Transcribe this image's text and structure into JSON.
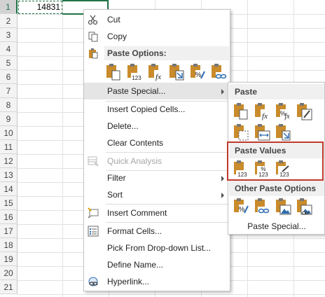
{
  "sheet": {
    "row_numbers": [
      "1",
      "2",
      "3",
      "4",
      "5",
      "6",
      "7",
      "8",
      "9",
      "10",
      "11",
      "12",
      "13",
      "14",
      "15",
      "16",
      "17",
      "18",
      "19",
      "20",
      "21"
    ],
    "cell_a1_value": "14831"
  },
  "context_menu": {
    "cut": "Cut",
    "copy": "Copy",
    "paste_options_header": "Paste Options:",
    "paste_special": "Paste Special...",
    "insert_copied_cells": "Insert Copied Cells...",
    "delete": "Delete...",
    "clear_contents": "Clear Contents",
    "quick_analysis": "Quick Analysis",
    "filter": "Filter",
    "sort": "Sort",
    "insert_comment": "Insert Comment",
    "format_cells": "Format Cells...",
    "pick_from_dropdown": "Pick From Drop-down List...",
    "define_name": "Define Name...",
    "hyperlink": "Hyperlink..."
  },
  "submenu": {
    "paste_header": "Paste",
    "paste_values_header": "Paste Values",
    "other_paste_options_header": "Other Paste Options",
    "paste_special_link": "Paste Special..."
  },
  "icon_text": {
    "n123": "123",
    "pct": "%",
    "fx": "fx"
  },
  "colors": {
    "excel_green": "#217346",
    "highlight_box": "#c0392b",
    "clipboard": "#c98b2b"
  }
}
